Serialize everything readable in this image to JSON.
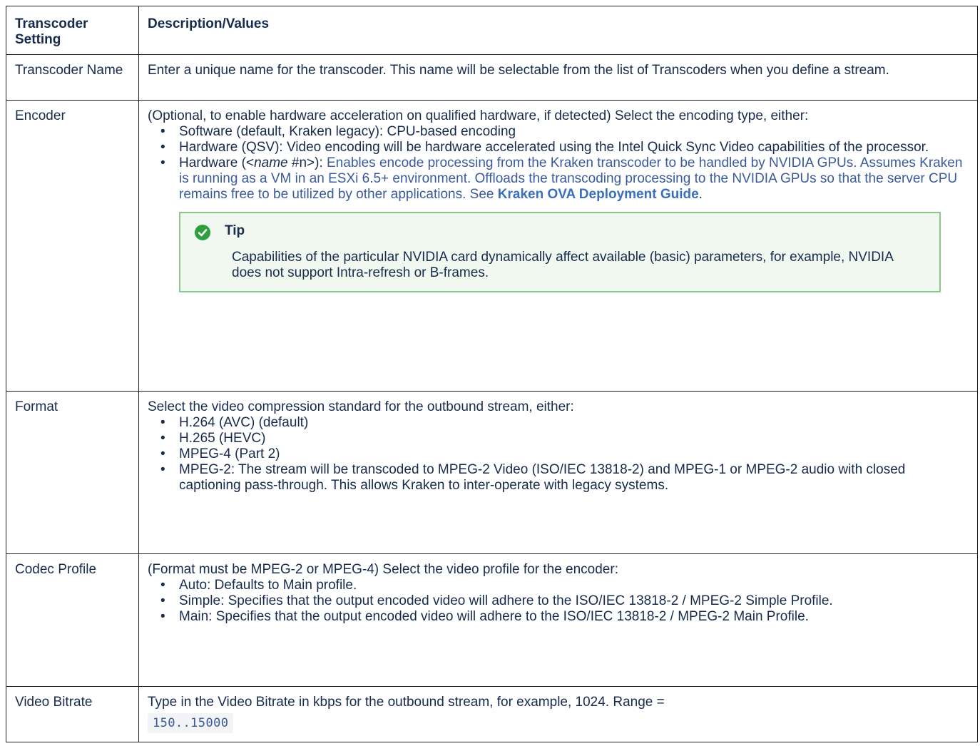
{
  "table": {
    "headers": {
      "setting": "Transcoder Setting",
      "description": "Description/Values"
    },
    "rows": {
      "name": {
        "setting": "Transcoder Name",
        "description": "Enter a unique name for the transcoder. This name will be selectable from the list of Transcoders when you define a stream."
      },
      "encoder": {
        "setting": "Encoder",
        "intro": "(Optional, to enable hardware acceleration on qualified hardware, if detected) Select the encoding type, either:",
        "items": [
          "Software (default, Kraken legacy): CPU-based encoding",
          "Hardware (QSV): Video encoding will be hardware accelerated using the Intel Quick Sync Video capabilities of the processor."
        ],
        "hw_prefix": "Hardware (<",
        "hw_name": "name",
        "hw_suffix": " #n>):",
        "hw_text": " Enables encode processing from the Kraken transcoder to be handled by NVIDIA GPUs. Assumes Kraken is running as a VM in an ESXi 6.5+ environment. Offloads the transcoding processing to the NVIDIA GPUs so that the server CPU remains free to be utilized by other applications. See ",
        "hw_link": "Kraken OVA Deployment Guide",
        "hw_end": ".",
        "tip_title": "Tip",
        "tip_body": "Capabilities of the particular NVIDIA card dynamically affect available (basic) parameters, for example, NVIDIA does not support Intra-refresh or B-frames."
      },
      "format": {
        "setting": "Format",
        "intro": "Select the video compression standard for the outbound stream, either:",
        "items": [
          "H.264 (AVC) (default)",
          "H.265 (HEVC)",
          "MPEG-4 (Part 2)",
          "MPEG-2: The stream will be transcoded to MPEG-2 Video (ISO/IEC 13818-2) and MPEG-1 or MPEG-2 audio with closed captioning pass-through. This allows Kraken to inter-operate with legacy systems."
        ]
      },
      "codec": {
        "setting": "Codec Profile",
        "intro": "(Format must be MPEG-2 or MPEG-4) Select the video profile for the encoder:",
        "items": [
          "Auto: Defaults to Main profile.",
          "Simple: Specifies that the output encoded video will adhere to the ISO/IEC 13818-2 / MPEG-2 Simple Profile.",
          "Main: Specifies that the output encoded video will adhere to the ISO/IEC 13818-2 / MPEG-2 Main Profile."
        ]
      },
      "bitrate": {
        "setting": "Video Bitrate",
        "description": "Type in the Video Bitrate in kbps for the outbound stream, for example, 1024. Range =",
        "range": "150..15000"
      }
    }
  },
  "colors": {
    "tip_icon": "#2e9e3e",
    "tip_border": "#8bc88b",
    "link": "#3a6fbf"
  }
}
